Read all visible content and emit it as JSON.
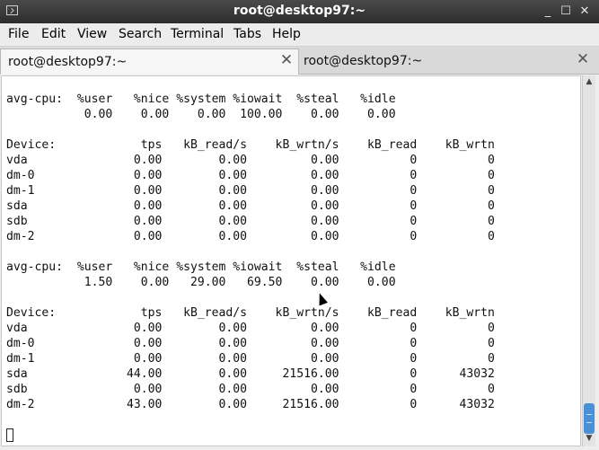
{
  "window": {
    "title": "root@desktop97:~",
    "minimize_glyph": "_",
    "maximize_glyph": "☐",
    "close_glyph": "✕"
  },
  "menu": {
    "items": [
      "File",
      "Edit",
      "View",
      "Search",
      "Terminal",
      "Tabs",
      "Help"
    ]
  },
  "tabs": [
    {
      "label": "root@desktop97:~",
      "active": true,
      "close_glyph": "✕"
    },
    {
      "label": "root@desktop97:~",
      "active": false,
      "close_glyph": "✕"
    }
  ],
  "terminal": {
    "text": "avg-cpu:  %user   %nice %system %iowait  %steal   %idle\n           0.00    0.00    0.00  100.00    0.00    0.00\n\nDevice:            tps   kB_read/s    kB_wrtn/s    kB_read    kB_wrtn\nvda               0.00        0.00         0.00          0          0\ndm-0              0.00        0.00         0.00          0          0\ndm-1              0.00        0.00         0.00          0          0\nsda               0.00        0.00         0.00          0          0\nsdb               0.00        0.00         0.00          0          0\ndm-2              0.00        0.00         0.00          0          0\n\navg-cpu:  %user   %nice %system %iowait  %steal   %idle\n           1.50    0.00   29.00   69.50    0.00    0.00\n\nDevice:            tps   kB_read/s    kB_wrtn/s    kB_read    kB_wrtn\nvda               0.00        0.00         0.00          0          0\ndm-0              0.00        0.00         0.00          0          0\ndm-1              0.00        0.00         0.00          0          0\nsda              44.00        0.00     21516.00          0      43032\nsdb               0.00        0.00         0.00          0          0\ndm-2             43.00        0.00     21516.00          0      43032"
  },
  "scrollbar": {
    "up_glyph": "▲",
    "down_glyph": "▼",
    "position": 0.98
  }
}
